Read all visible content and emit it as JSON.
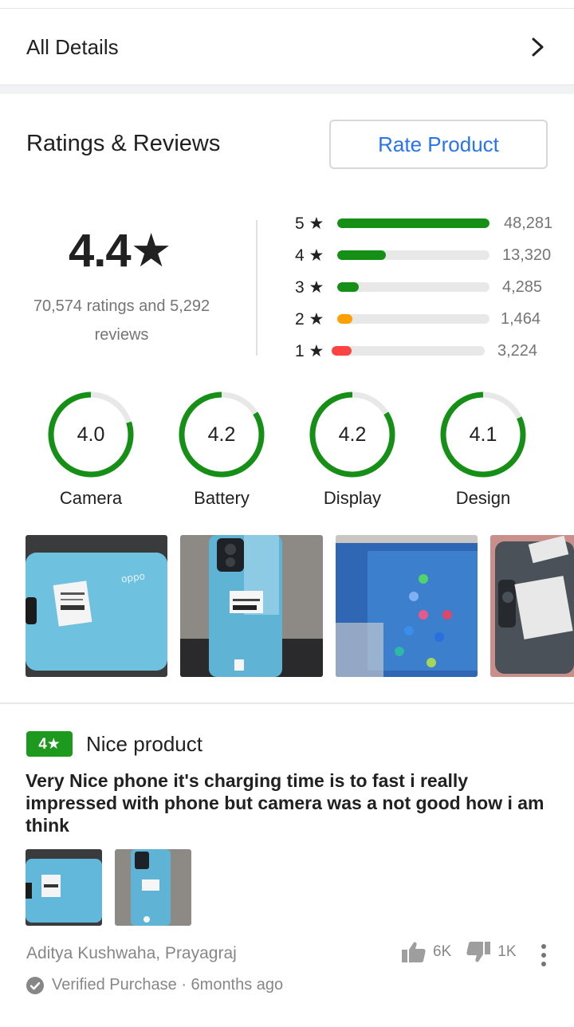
{
  "all_details": {
    "label": "All Details"
  },
  "ratings": {
    "title": "Ratings & Reviews",
    "rate_button": "Rate Product",
    "average": "4.4★",
    "summary": "70,574 ratings and 5,292 reviews",
    "bars": [
      {
        "label": "5 ★",
        "count": "48,281",
        "fraction": 1.0,
        "color": "#168f16"
      },
      {
        "label": "4 ★",
        "count": "13,320",
        "fraction": 0.32,
        "color": "#168f16"
      },
      {
        "label": "3 ★",
        "count": "4,285",
        "fraction": 0.14,
        "color": "#168f16"
      },
      {
        "label": "2 ★",
        "count": "1,464",
        "fraction": 0.1,
        "color": "#ff9f00"
      },
      {
        "label": "1 ★",
        "count": "3,224",
        "fraction": 0.13,
        "color": "#ff4343"
      }
    ],
    "features": [
      {
        "value": "4.0",
        "label": "Camera",
        "score": 0.8
      },
      {
        "value": "4.2",
        "label": "Battery",
        "score": 0.84
      },
      {
        "value": "4.2",
        "label": "Display",
        "score": 0.84
      },
      {
        "value": "4.1",
        "label": "Design",
        "score": 0.82
      }
    ]
  },
  "review": {
    "rating_badge": "4★",
    "title": "Nice product",
    "body": "Very Nice phone it's charging time is to fast  i  really impressed with phone but camera was a not good how i am think",
    "author": "Aditya Kushwaha, Prayagraj",
    "verified": "Verified Purchase · 6months ago",
    "likes": "6K",
    "dislikes": "1K"
  },
  "colors": {
    "green": "#168f16",
    "accent_blue": "#2874f0",
    "track": "#e8e8e8"
  }
}
